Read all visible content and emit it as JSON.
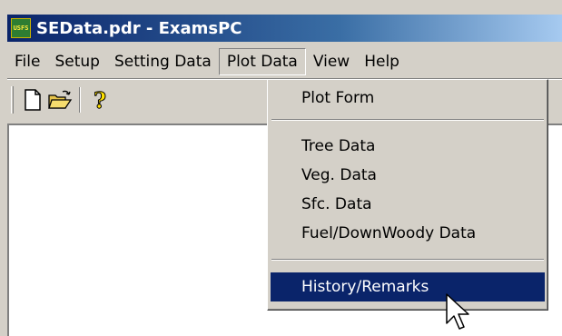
{
  "window": {
    "title": "SEData.pdr - ExamsPC",
    "app_icon_text": "USFS"
  },
  "menubar": {
    "items": [
      {
        "label": "File"
      },
      {
        "label": "Setup"
      },
      {
        "label": "Setting Data"
      },
      {
        "label": "Plot Data"
      },
      {
        "label": "View"
      },
      {
        "label": "Help"
      }
    ],
    "active": "Plot Data"
  },
  "toolbar": {
    "buttons": [
      {
        "icon": "new-document-icon"
      },
      {
        "icon": "open-folder-icon"
      },
      {
        "icon": "help-icon"
      }
    ]
  },
  "plot_data_menu": {
    "items": [
      {
        "label": "Plot Form"
      },
      {
        "label": "Tree Data"
      },
      {
        "label": "Veg. Data"
      },
      {
        "label": "Sfc. Data"
      },
      {
        "label": "Fuel/DownWoody Data"
      },
      {
        "label": "History/Remarks"
      }
    ],
    "selected": "History/Remarks"
  },
  "colors": {
    "titlebar_start": "#0a246a",
    "titlebar_end": "#a6caf0",
    "selection": "#0a246a",
    "face": "#d4d0c8"
  }
}
